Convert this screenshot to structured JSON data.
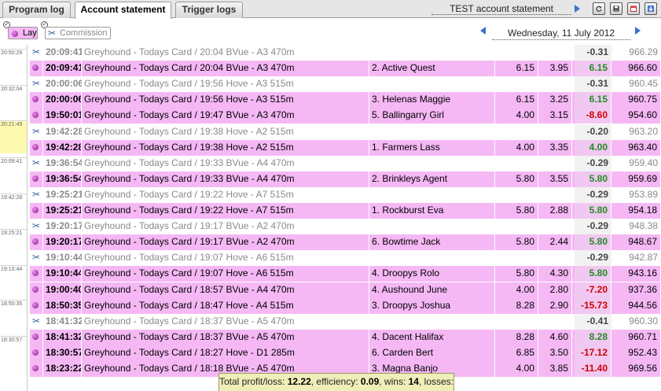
{
  "tabs": [
    {
      "label": "Program log",
      "active": false
    },
    {
      "label": "Account statement",
      "active": true
    },
    {
      "label": "Trigger logs",
      "active": false
    }
  ],
  "header": {
    "account_title": "TEST account statement",
    "toolbar_icons": [
      "refresh-icon",
      "save-icon",
      "calendar-icon",
      "download-icon"
    ]
  },
  "filters": {
    "lay_label": "Lay",
    "commission_label": "Commission",
    "date": "Wednesday, 11 July 2012"
  },
  "time_ticks": [
    {
      "label": "20:50:29",
      "highlight": false
    },
    {
      "label": "20:32:04",
      "highlight": false
    },
    {
      "label": "20:21:49",
      "highlight": true
    },
    {
      "label": "20:09:41",
      "highlight": false
    },
    {
      "label": "19:42:28",
      "highlight": false
    },
    {
      "label": "19:25:21",
      "highlight": false
    },
    {
      "label": "19:10:44",
      "highlight": false
    },
    {
      "label": "18:50:35",
      "highlight": false
    },
    {
      "label": "18:30:57",
      "highlight": false
    }
  ],
  "rows": [
    {
      "type": "comm",
      "time": "20:09:41",
      "desc": "Greyhound - Todays Card / 20:04 BVue - A3 470m",
      "runner": "",
      "odds": "",
      "stake": "",
      "pl": "-0.31",
      "balance": "966.29"
    },
    {
      "type": "lay",
      "time": "20:09:41",
      "desc": "Greyhound - Todays Card / 20:04 BVue - A3 470m",
      "runner": "2. Active Quest",
      "odds": "6.15",
      "stake": "3.95",
      "pl": "6.15",
      "balance": "966.60"
    },
    {
      "type": "comm",
      "time": "20:00:06",
      "desc": "Greyhound - Todays Card / 19:56 Hove - A3 515m",
      "runner": "",
      "odds": "",
      "stake": "",
      "pl": "-0.31",
      "balance": "960.45"
    },
    {
      "type": "lay",
      "time": "20:00:06",
      "desc": "Greyhound - Todays Card / 19:56 Hove - A3 515m",
      "runner": "3. Helenas Maggie",
      "odds": "6.15",
      "stake": "3.25",
      "pl": "6.15",
      "balance": "960.75"
    },
    {
      "type": "lay",
      "time": "19:50:01",
      "desc": "Greyhound - Todays Card / 19:47 BVue - A3 470m",
      "runner": "5. Ballingarry Girl",
      "odds": "4.00",
      "stake": "3.15",
      "pl": "-8.60",
      "balance": "954.60"
    },
    {
      "type": "comm",
      "time": "19:42:28",
      "desc": "Greyhound - Todays Card / 19:38 Hove - A2 515m",
      "runner": "",
      "odds": "",
      "stake": "",
      "pl": "-0.20",
      "balance": "963.20"
    },
    {
      "type": "lay",
      "time": "19:42:28",
      "desc": "Greyhound - Todays Card / 19:38 Hove - A2 515m",
      "runner": "1. Farmers Lass",
      "odds": "4.00",
      "stake": "3.35",
      "pl": "4.00",
      "balance": "963.40"
    },
    {
      "type": "comm",
      "time": "19:36:54",
      "desc": "Greyhound - Todays Card / 19:33 BVue - A4 470m",
      "runner": "",
      "odds": "",
      "stake": "",
      "pl": "-0.29",
      "balance": "959.40"
    },
    {
      "type": "lay",
      "time": "19:36:54",
      "desc": "Greyhound - Todays Card / 19:33 BVue - A4 470m",
      "runner": "2. Brinkleys Agent",
      "odds": "5.80",
      "stake": "3.55",
      "pl": "5.80",
      "balance": "959.69"
    },
    {
      "type": "comm",
      "time": "19:25:21",
      "desc": "Greyhound - Todays Card / 19:22 Hove - A7 515m",
      "runner": "",
      "odds": "",
      "stake": "",
      "pl": "-0.29",
      "balance": "953.89"
    },
    {
      "type": "lay",
      "time": "19:25:21",
      "desc": "Greyhound - Todays Card / 19:22 Hove - A7 515m",
      "runner": "1. Rockburst Eva",
      "odds": "5.80",
      "stake": "2.88",
      "pl": "5.80",
      "balance": "954.18"
    },
    {
      "type": "comm",
      "time": "19:20:17",
      "desc": "Greyhound - Todays Card / 19:17 BVue - A2 470m",
      "runner": "",
      "odds": "",
      "stake": "",
      "pl": "-0.29",
      "balance": "948.38"
    },
    {
      "type": "lay",
      "time": "19:20:17",
      "desc": "Greyhound - Todays Card / 19:17 BVue - A2 470m",
      "runner": "6. Bowtime Jack",
      "odds": "5.80",
      "stake": "2.44",
      "pl": "5.80",
      "balance": "948.67"
    },
    {
      "type": "comm",
      "time": "19:10:44",
      "desc": "Greyhound - Todays Card / 19:07 Hove - A6 515m",
      "runner": "",
      "odds": "",
      "stake": "",
      "pl": "-0.29",
      "balance": "942.87"
    },
    {
      "type": "lay",
      "time": "19:10:44",
      "desc": "Greyhound - Todays Card / 19:07 Hove - A6 515m",
      "runner": "4. Droopys Rolo",
      "odds": "5.80",
      "stake": "4.30",
      "pl": "5.80",
      "balance": "943.16"
    },
    {
      "type": "lay",
      "time": "19:00:40",
      "desc": "Greyhound - Todays Card / 18:57 BVue - A4 470m",
      "runner": "4. Aushound June",
      "odds": "4.00",
      "stake": "2.80",
      "pl": "-7.20",
      "balance": "937.36"
    },
    {
      "type": "lay",
      "time": "18:50:35",
      "desc": "Greyhound - Todays Card / 18:47 Hove - A4 515m",
      "runner": "3. Droopys Joshua",
      "odds": "8.28",
      "stake": "2.90",
      "pl": "-15.73",
      "balance": "944.56"
    },
    {
      "type": "comm",
      "time": "18:41:32",
      "desc": "Greyhound - Todays Card / 18:37 BVue - A5 470m",
      "runner": "",
      "odds": "",
      "stake": "",
      "pl": "-0.41",
      "balance": "960.30"
    },
    {
      "type": "lay",
      "time": "18:41:32",
      "desc": "Greyhound - Todays Card / 18:37 BVue - A5 470m",
      "runner": "4. Dacent Halifax",
      "odds": "8.28",
      "stake": "4.60",
      "pl": "8.28",
      "balance": "960.71"
    },
    {
      "type": "lay",
      "time": "18:30:57",
      "desc": "Greyhound - Todays Card / 18:27 Hove - D1 285m",
      "runner": "6. Carden Bert",
      "odds": "6.85",
      "stake": "3.50",
      "pl": "-17.12",
      "balance": "952.43"
    },
    {
      "type": "lay",
      "time": "18:23:22",
      "desc": "Greyhound - Todays Card / 18:18 BVue - A5 470m",
      "runner": "3. Magna Banjo",
      "odds": "4.00",
      "stake": "3.85",
      "pl": "-11.40",
      "balance": "969.56"
    }
  ],
  "summary": {
    "profit_label": "Total profit/loss:",
    "profit_value": "12.22",
    "efficiency_label": ", efficiency:",
    "efficiency_value": "0.09",
    "wins_label": ", wins:",
    "wins_value": "14",
    "losses_label": ", losses:",
    "losses_value": "5"
  },
  "colors": {
    "lay_row": "#f5b8f5",
    "positive": "#228b22",
    "negative": "#d10000",
    "summary_bg": "#eeeeb8",
    "nav_arrow": "#3a6fd0"
  }
}
